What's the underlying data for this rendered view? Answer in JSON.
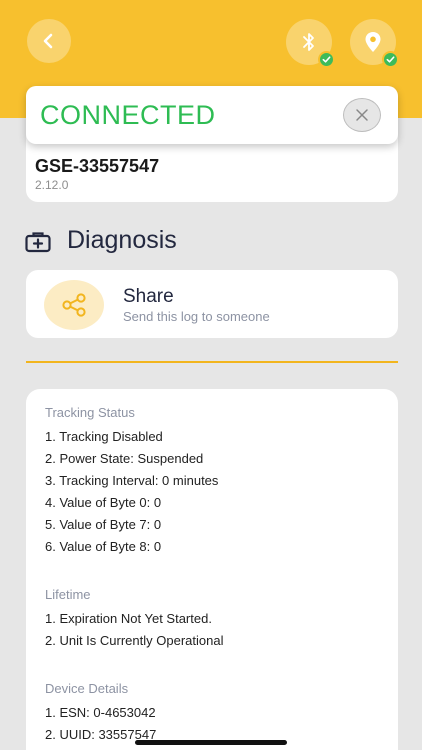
{
  "header": {
    "background_color": "#f7c02e",
    "back_icon": "chevron-left-icon",
    "bluetooth_icon": "bluetooth-icon",
    "location_icon": "location-pin-icon",
    "badge_icon": "check-icon"
  },
  "connection": {
    "status": "CONNECTED",
    "status_color": "#2ebc53",
    "close_icon": "close-icon"
  },
  "device": {
    "name": "GSE-33557547",
    "version": "2.12.0"
  },
  "diagnosis": {
    "title": "Diagnosis",
    "icon": "medical-kit-icon"
  },
  "share": {
    "title": "Share",
    "subtitle": "Send this log to someone",
    "icon": "share-icon"
  },
  "log": {
    "sections": [
      {
        "title": "Tracking Status",
        "lines": [
          "1. Tracking Disabled",
          "2. Power State: Suspended",
          "3. Tracking Interval: 0 minutes",
          "4. Value of Byte 0: 0",
          "5. Value of Byte 7: 0",
          "6. Value of Byte 8: 0"
        ]
      },
      {
        "title": "Lifetime",
        "lines": [
          "1. Expiration Not Yet Started.",
          "2. Unit Is Currently Operational"
        ]
      },
      {
        "title": "Device Details",
        "lines": [
          "1. ESN:  0-4653042",
          "2. UUID:  33557547"
        ]
      }
    ]
  }
}
